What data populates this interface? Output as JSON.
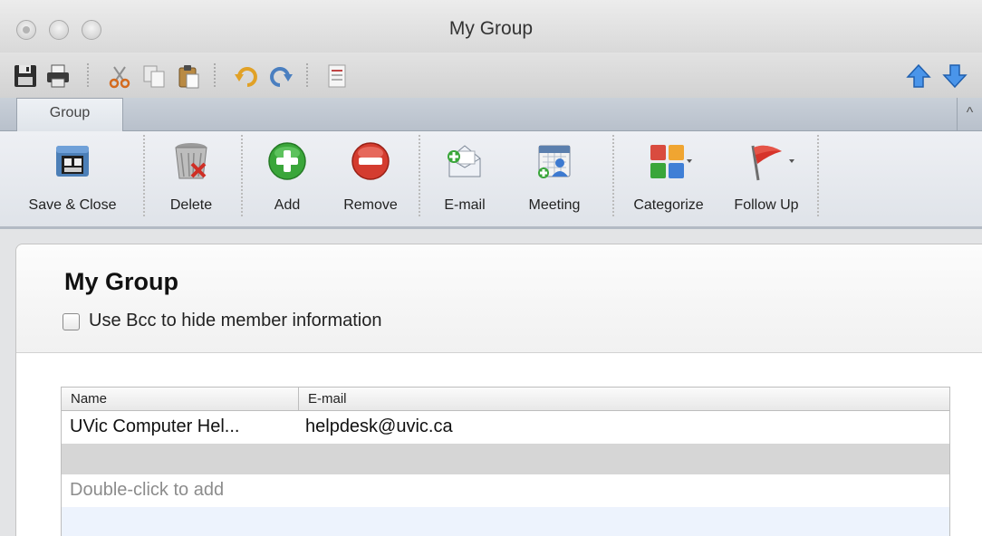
{
  "window": {
    "title": "My Group"
  },
  "quick_toolbar": {
    "items": [
      "save-icon",
      "print-icon",
      "cut-icon",
      "copy-icon",
      "paste-icon",
      "undo-icon",
      "redo-icon",
      "properties-icon",
      "up-arrow-icon",
      "down-arrow-icon"
    ]
  },
  "tabs": {
    "items": [
      {
        "label": "Group",
        "active": true
      }
    ]
  },
  "ribbon": {
    "buttons": [
      {
        "label": "Save & Close",
        "icon": "save-close-icon"
      },
      {
        "label": "Delete",
        "icon": "trash-icon"
      },
      {
        "label": "Add",
        "icon": "add-icon"
      },
      {
        "label": "Remove",
        "icon": "remove-icon"
      },
      {
        "label": "E-mail",
        "icon": "email-icon"
      },
      {
        "label": "Meeting",
        "icon": "meeting-icon"
      },
      {
        "label": "Categorize",
        "icon": "categorize-icon"
      },
      {
        "label": "Follow Up",
        "icon": "flag-icon"
      }
    ]
  },
  "group": {
    "name": "My Group",
    "bcc_label": "Use Bcc to hide member information",
    "bcc_checked": false
  },
  "members": {
    "columns": [
      "Name",
      "E-mail"
    ],
    "rows": [
      {
        "name": "UVic Computer Hel...",
        "email": "helpdesk@uvic.ca"
      }
    ],
    "placeholder": "Double-click to add"
  },
  "colors": {
    "add_green": "#3aa63a",
    "remove_red": "#d43c2f",
    "arrow_blue": "#2b7be4",
    "flag_red": "#d6332a"
  }
}
